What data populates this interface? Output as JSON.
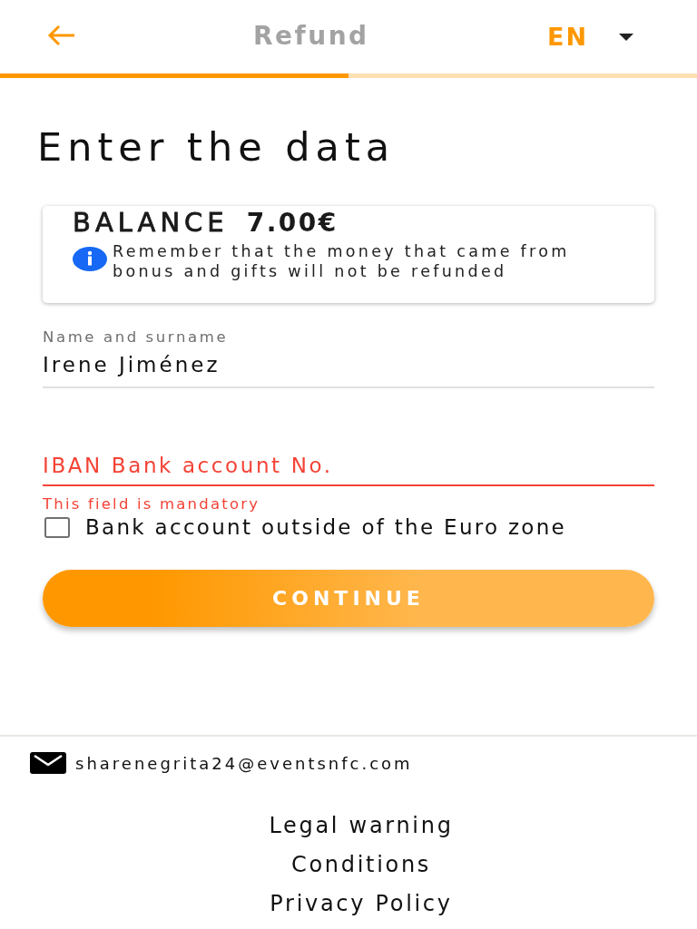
{
  "header": {
    "title": "Refund",
    "language": "EN"
  },
  "progress": {
    "level": 0.5
  },
  "heading": "Enter the data",
  "balance_card": {
    "label": "BALANCE",
    "amount": "7.00€",
    "note": "Remember that the money that came from bonus and gifts will not be refunded"
  },
  "fields": [
    {
      "label": "Name and surname",
      "value": "Irene Jiménez",
      "error": false
    },
    {
      "placeholder": "IBAN Bank account No.",
      "error": true,
      "error_text": "This field is mandatory"
    }
  ],
  "checkbox": {
    "label": "Bank account outside of the Euro zone",
    "checked": false
  },
  "continue_button": "CONTINUE",
  "footer": {
    "email": "sharenegrita24@eventsnfc.com",
    "links": [
      "Legal warning",
      "Conditions",
      "Privacy Policy"
    ]
  }
}
